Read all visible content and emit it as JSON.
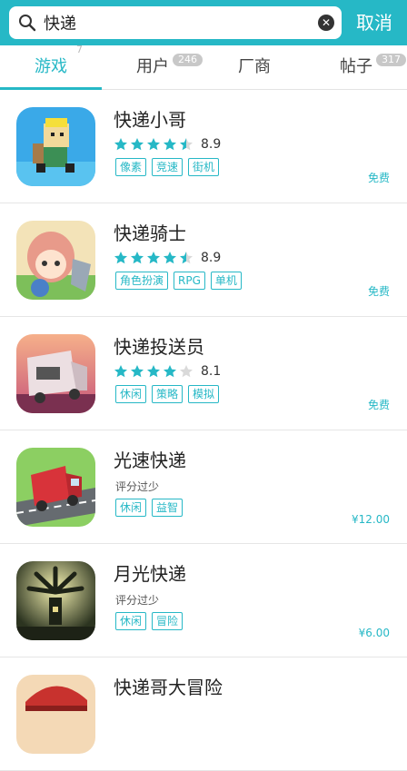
{
  "search": {
    "value": "快递",
    "cancel_label": "取消"
  },
  "tabs": [
    {
      "label": "游戏",
      "count": "7",
      "active": true
    },
    {
      "label": "用户",
      "count": "246",
      "active": false
    },
    {
      "label": "厂商",
      "count": "",
      "active": false
    },
    {
      "label": "帖子",
      "count": "317",
      "active": false
    }
  ],
  "apps": [
    {
      "title": "快递小哥",
      "rating": 4.5,
      "score": "8.9",
      "tags": [
        "像素",
        "竞速",
        "街机"
      ],
      "price": "免费",
      "icon": "pixel-courier-icon"
    },
    {
      "title": "快递骑士",
      "rating": 4.5,
      "score": "8.9",
      "tags": [
        "角色扮演",
        "RPG",
        "单机"
      ],
      "price": "免费",
      "icon": "anime-knight-icon"
    },
    {
      "title": "快递投送员",
      "rating": 4,
      "score": "8.1",
      "tags": [
        "休闲",
        "策略",
        "模拟"
      ],
      "price": "免费",
      "icon": "delivery-truck-dusk-icon"
    },
    {
      "title": "光速快递",
      "rating_text": "评分过少",
      "tags": [
        "休闲",
        "益智"
      ],
      "price": "¥12.00",
      "icon": "red-truck-road-icon"
    },
    {
      "title": "月光快递",
      "rating_text": "评分过少",
      "tags": [
        "休闲",
        "冒险"
      ],
      "price": "¥6.00",
      "icon": "moon-windmill-icon"
    },
    {
      "title": "快递哥大冒险",
      "icon": "red-cap-icon"
    }
  ],
  "colors": {
    "accent": "#26b8c6",
    "star_empty": "#d9d9d9"
  }
}
